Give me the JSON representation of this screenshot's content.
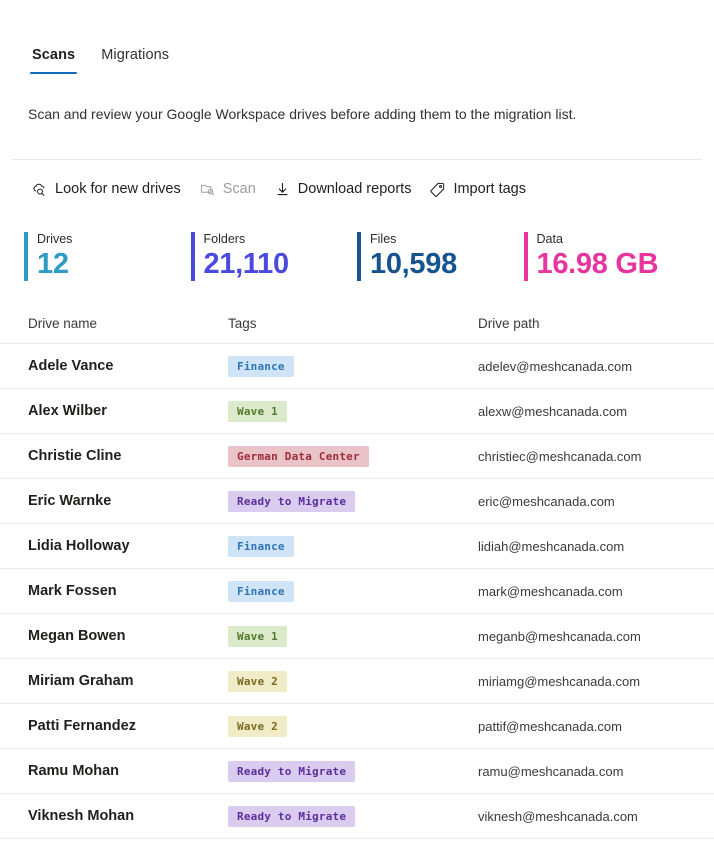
{
  "tabs": [
    {
      "label": "Scans",
      "active": true
    },
    {
      "label": "Migrations",
      "active": false
    }
  ],
  "description": "Scan and review your Google Workspace drives before adding them to the migration list.",
  "toolbar": [
    {
      "label": "Look for new drives",
      "icon": "cloud-search-icon",
      "disabled": false
    },
    {
      "label": "Scan",
      "icon": "scan-icon",
      "disabled": true
    },
    {
      "label": "Download reports",
      "icon": "download-icon",
      "disabled": false
    },
    {
      "label": "Import tags",
      "icon": "tag-icon",
      "disabled": false
    }
  ],
  "stats": [
    {
      "label": "Drives",
      "value": "12",
      "color": "#2e9bc5"
    },
    {
      "label": "Folders",
      "value": "21,110",
      "color": "#4a4ae0"
    },
    {
      "label": "Files",
      "value": "10,598",
      "color": "#16548f"
    },
    {
      "label": "Data",
      "value": "16.98 GB",
      "color": "#e8359e"
    }
  ],
  "table": {
    "columns": [
      "Drive name",
      "Tags",
      "Drive path"
    ],
    "tag_styles": {
      "Finance": {
        "bg": "#cfe4f7",
        "fg": "#2e74b5"
      },
      "Wave 1": {
        "bg": "#dbeacb",
        "fg": "#537a2b"
      },
      "German Data Center": {
        "bg": "#e9c3c7",
        "fg": "#9e2b3b"
      },
      "Ready to Migrate": {
        "bg": "#d9ccee",
        "fg": "#5b2d9e"
      },
      "Wave 2": {
        "bg": "#f0ecc8",
        "fg": "#7a6a1e"
      }
    },
    "rows": [
      {
        "name": "Adele Vance",
        "tag": "Finance",
        "path": "adelev@meshcanada.com"
      },
      {
        "name": "Alex Wilber",
        "tag": "Wave 1",
        "path": "alexw@meshcanada.com"
      },
      {
        "name": "Christie Cline",
        "tag": "German Data Center",
        "path": "christiec@meshcanada.com"
      },
      {
        "name": "Eric Warnke",
        "tag": "Ready to Migrate",
        "path": "eric@meshcanada.com"
      },
      {
        "name": "Lidia Holloway",
        "tag": "Finance",
        "path": "lidiah@meshcanada.com"
      },
      {
        "name": "Mark Fossen",
        "tag": "Finance",
        "path": "mark@meshcanada.com"
      },
      {
        "name": "Megan Bowen",
        "tag": "Wave 1",
        "path": "meganb@meshcanada.com"
      },
      {
        "name": "Miriam Graham",
        "tag": "Wave 2",
        "path": "miriamg@meshcanada.com"
      },
      {
        "name": "Patti Fernandez",
        "tag": "Wave 2",
        "path": "pattif@meshcanada.com"
      },
      {
        "name": "Ramu Mohan",
        "tag": "Ready to Migrate",
        "path": "ramu@meshcanada.com"
      },
      {
        "name": "Viknesh Mohan",
        "tag": "Ready to Migrate",
        "path": "viknesh@meshcanada.com"
      }
    ]
  }
}
